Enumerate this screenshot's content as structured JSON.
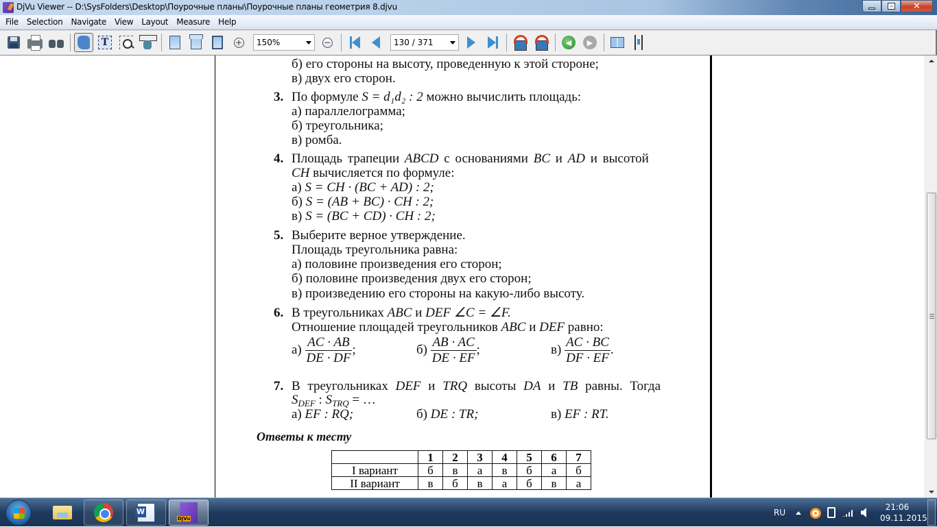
{
  "window": {
    "title": "DjVu Viewer -- D:\\SysFolders\\Desktop\\Поурочные планы\\Поурочные планы геометрия 8.djvu",
    "minimize": "—",
    "restore": "❐",
    "close": "✕"
  },
  "menu": [
    "File",
    "Selection",
    "Navigate",
    "View",
    "Layout",
    "Measure",
    "Help"
  ],
  "toolbar": {
    "icons": [
      "save-icon",
      "print-icon",
      "find-icon",
      "hand-tool-icon",
      "text-select-icon",
      "zoom-select-icon",
      "ruler-measure-icon",
      "single-page-icon",
      "two-page-icon",
      "fit-page-icon",
      "zoom-in-icon",
      "zoom-out-icon",
      "first-page-icon",
      "prev-page-icon",
      "next-page-icon",
      "last-page-icon",
      "rotate-left-icon",
      "rotate-right-icon",
      "back-icon",
      "forward-icon",
      "facing-pages-icon",
      "continuous-icon"
    ],
    "zoom_in": "+",
    "zoom_out": "−",
    "zoom_value": "150%",
    "page_value": "130 / 371",
    "back_glyph": "◀",
    "forward_glyph": "▶",
    "active_tool": "hand-tool"
  },
  "document": {
    "lines": {
      "q2b": "б) его стороны на высоту, проведенную к этой стороне;",
      "q2c": "в) двух его сторон.",
      "q3_num": "3.",
      "q3_pre": "По формуле ",
      "q3_formula": "S = d₁d₂ : 2",
      "q3_post": " можно вычислить площадь:",
      "q3a": "а) параллелограмма;",
      "q3b": "б) треугольника;",
      "q3c": "в) ромба.",
      "q4_num": "4.",
      "q4_text1_a": "Площадь трапеции ",
      "q4_abcd": "ABCD",
      "q4_text1_b": " с основаниями ",
      "q4_bc": "BC",
      "q4_and": " и ",
      "q4_ad": "AD",
      "q4_text1_c": " и высотой",
      "q4_ch": "CH",
      "q4_text2": " вычисляется по формуле:",
      "q4a_label": "а) ",
      "q4a": "S = CH · (BC + AD) : 2;",
      "q4b_label": "б) ",
      "q4b": "S = (AB + BC) · CH : 2;",
      "q4c_label": "в) ",
      "q4c": "S = (BC + CD) · CH : 2;",
      "q5_num": "5.",
      "q5_text": "Выберите верное утверждение.",
      "q5_sub": "Площадь треугольника равна:",
      "q5a": "а) половине произведения его сторон;",
      "q5b": "б) половине произведения двух его сторон;",
      "q5c": "в) произведению его стороны на какую-либо высоту.",
      "q6_num": "6.",
      "q6_pre": "В треугольниках ",
      "q6_abc": "ABC",
      "q6_and": " и ",
      "q6_def": "DEF",
      "q6_angle": " ∠C = ∠F.",
      "q6_sub_pre": "Отношение площадей треугольников ",
      "q6_sub_abc": "ABC",
      "q6_sub_and": " и ",
      "q6_sub_def": "DEF",
      "q6_sub_post": " равно:",
      "q6a_label": "а)",
      "q6a_num": "AC · AB",
      "q6a_den": "DE · DF",
      "q6a_end": ";",
      "q6b_label": "б)",
      "q6b_num": "AB · AC",
      "q6b_den": "DE · EF",
      "q6b_end": ";",
      "q6c_label": "в)",
      "q6c_num": "AC · BC",
      "q6c_den": "DF · EF",
      "q6c_end": ".",
      "q7_num": "7.",
      "q7_pre": "В треугольниках ",
      "q7_def": "DEF",
      "q7_and1": " и ",
      "q7_trq": "TRQ",
      "q7_mid": " высоты ",
      "q7_da": "DA",
      "q7_and2": " и ",
      "q7_tb": "TB",
      "q7_post": " равны. Тогда",
      "q7_ratio_s1": "S",
      "q7_ratio_sub1": "DEF",
      "q7_ratio_colon": " : ",
      "q7_ratio_s2": "S",
      "q7_ratio_sub2": "TRQ",
      "q7_ratio_end": " = …",
      "q7a_label": "а) ",
      "q7a": "EF : RQ;",
      "q7b_label": "б) ",
      "q7b": "DE : TR;",
      "q7c_label": "в) ",
      "q7c": "EF : RT.",
      "answers_heading": "Ответы к тесту"
    },
    "answers_table": {
      "columns": [
        "",
        "1",
        "2",
        "3",
        "4",
        "5",
        "6",
        "7"
      ],
      "rows": [
        {
          "label": "I вариант",
          "values": [
            "б",
            "в",
            "а",
            "в",
            "б",
            "а",
            "б"
          ]
        },
        {
          "label": "II вариант",
          "values": [
            "в",
            "б",
            "в",
            "а",
            "б",
            "в",
            "а"
          ]
        }
      ]
    }
  },
  "taskbar": {
    "apps": [
      "windows-explorer",
      "google-chrome",
      "microsoft-word",
      "djvu-viewer"
    ],
    "language": "RU",
    "time": "21:06",
    "date": "09.11.2015"
  }
}
